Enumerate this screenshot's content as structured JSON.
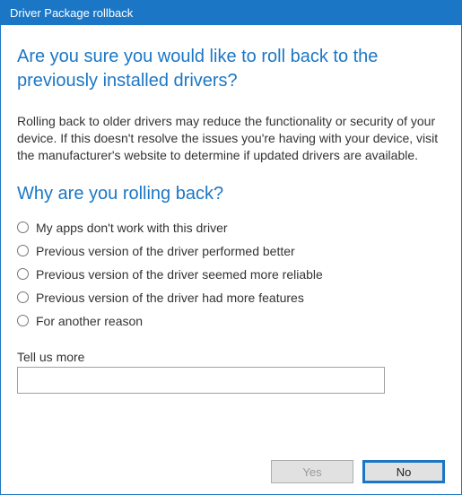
{
  "titlebar": {
    "title": "Driver Package rollback"
  },
  "main": {
    "heading": "Are you sure you would like to roll back to the previously installed drivers?",
    "description": "Rolling back to older drivers may reduce the functionality or security of your device.  If this doesn't resolve the issues you're having with your device, visit the manufacturer's website to determine if updated drivers are available.",
    "subheading": "Why are you rolling back?",
    "reasons": [
      "My apps don't work with this driver",
      "Previous version of the driver performed better",
      "Previous version of the driver seemed more reliable",
      "Previous version of the driver had more features",
      "For another reason"
    ],
    "tell_us_more_label": "Tell us more",
    "tell_us_more_value": ""
  },
  "buttons": {
    "yes_label": "Yes",
    "no_label": "No"
  }
}
